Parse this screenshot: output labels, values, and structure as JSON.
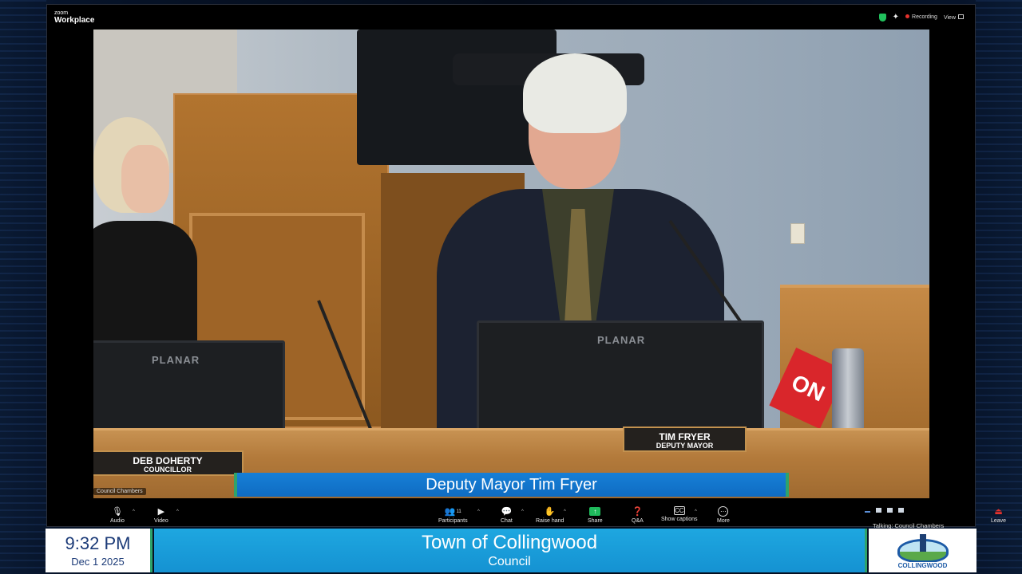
{
  "zoom": {
    "logo_small": "zoom",
    "logo_main": "Workplace",
    "status": {
      "recording_label": "Recording",
      "view_label": "View"
    }
  },
  "video": {
    "participant_label": "Council Chambers",
    "nameplates": [
      {
        "name": "DEB DOHERTY",
        "title": "COUNCILLOR"
      },
      {
        "name": "TIM FRYER",
        "title": "DEPUTY MAYOR"
      }
    ],
    "monitor_brand": "PLANAR",
    "sign_text": "ON",
    "caption": "Deputy Mayor Tim Fryer"
  },
  "toolbar": {
    "audio": "Audio",
    "video": "Video",
    "participants": "Participants",
    "participants_count": "11",
    "chat": "Chat",
    "raise_hand": "Raise hand",
    "share": "Share",
    "qa": "Q&A",
    "captions": "Show captions",
    "more": "More",
    "talking": "Talking: Council Chambers",
    "leave": "Leave"
  },
  "lower_third": {
    "time": "9:32 PM",
    "date": "Dec 1 2025",
    "title": "Town of Collingwood",
    "subtitle": "Council",
    "logo_text": "COLLINGWOOD"
  },
  "colors": {
    "caption_blue": "#0f6cc2",
    "accent_green": "#2fa36b",
    "title_blue": "#1ea7e0",
    "record_red": "#e5322d",
    "share_green": "#1fba5c"
  },
  "icons": [
    "shield-icon",
    "sparkle-icon",
    "record-dot-icon",
    "grid-view-icon",
    "mic-muted-icon",
    "camera-off-icon",
    "participants-icon",
    "chat-icon",
    "raise-hand-icon",
    "share-screen-icon",
    "qa-icon",
    "captions-icon",
    "more-icon",
    "leave-icon"
  ]
}
